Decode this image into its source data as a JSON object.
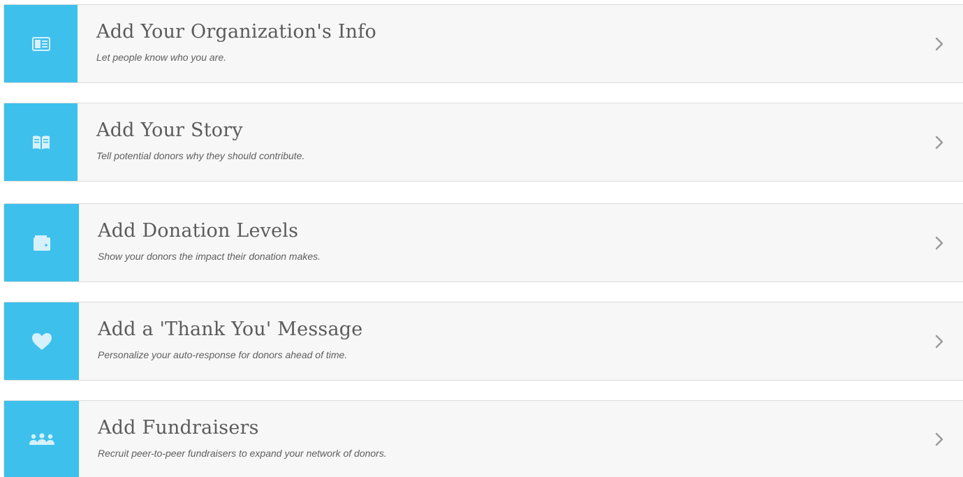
{
  "colors": {
    "accent": "#3ec0ec",
    "card_bg": "#f7f7f7",
    "title_text": "#5b5b5b",
    "subtitle_text": "#5e5e5e"
  },
  "steps": [
    {
      "icon": "id-card-icon",
      "title": "Add Your Organization's Info",
      "subtitle": "Let people know who you are."
    },
    {
      "icon": "open-book-icon",
      "title": "Add Your Story",
      "subtitle": "Tell potential donors why they should contribute."
    },
    {
      "icon": "wallet-icon",
      "title": "Add Donation Levels",
      "subtitle": "Show your donors the impact their donation makes."
    },
    {
      "icon": "heart-icon",
      "title": "Add a 'Thank You' Message",
      "subtitle": "Personalize your auto-response for donors ahead of time."
    },
    {
      "icon": "group-icon",
      "title": "Add Fundraisers",
      "subtitle": "Recruit peer-to-peer fundraisers to expand your network of donors."
    }
  ]
}
